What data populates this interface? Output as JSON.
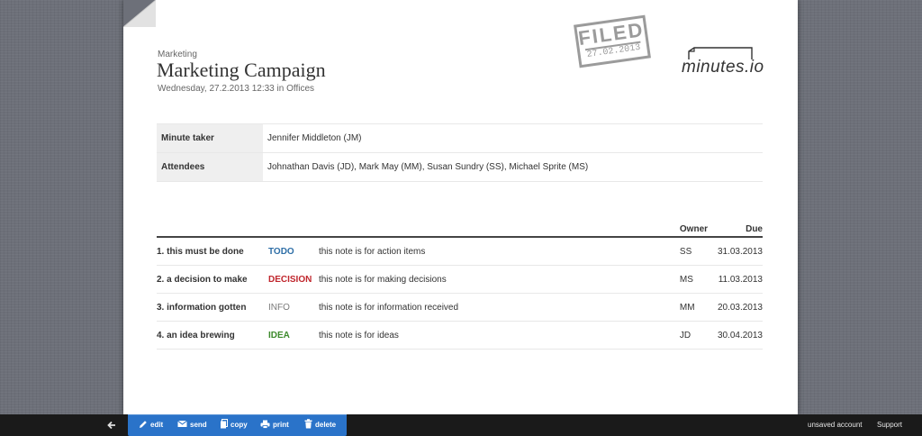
{
  "header": {
    "category": "Marketing",
    "title": "Marketing Campaign",
    "subtitle": "Wednesday, 27.2.2013 12:33 in Offices"
  },
  "stamp": {
    "word": "FILED",
    "date": "27.02.2013"
  },
  "logo": {
    "text": "minutes.io"
  },
  "meta": {
    "rows": [
      {
        "label": "Minute taker",
        "value": "Jennifer Middleton (JM)"
      },
      {
        "label": "Attendees",
        "value": "Johnathan Davis (JD), Mark May (MM), Susan Sundry (SS), Michael Sprite (MS)"
      }
    ]
  },
  "items": {
    "headers": {
      "owner": "Owner",
      "due": "Due"
    },
    "rows": [
      {
        "title": "1. this must be done",
        "type": "TODO",
        "note": "this note is for action items",
        "owner": "SS",
        "due": "31.03.2013",
        "type_color": "#2f6fa7"
      },
      {
        "title": "2. a decision to make",
        "type": "DECISION",
        "note": "this note is for making decisions",
        "owner": "MS",
        "due": "11.03.2013",
        "type_color": "#c0262d"
      },
      {
        "title": "3. information gotten",
        "type": "INFO",
        "note": "this note is for information received",
        "owner": "MM",
        "due": "20.03.2013",
        "type_color": "#7a7a7a"
      },
      {
        "title": "4. an idea brewing",
        "type": "IDEA",
        "note": "this note is for ideas",
        "owner": "JD",
        "due": "30.04.2013",
        "type_color": "#3d8a2c"
      }
    ]
  },
  "toolbar": {
    "back_icon": "arrow-left-icon",
    "accent": "#2a73c9",
    "actions": [
      {
        "label": "edit",
        "icon": "pencil-icon"
      },
      {
        "label": "send",
        "icon": "envelope-icon"
      },
      {
        "label": "copy",
        "icon": "copy-icon"
      },
      {
        "label": "print",
        "icon": "printer-icon"
      },
      {
        "label": "delete",
        "icon": "trash-icon"
      }
    ],
    "links": {
      "account": "unsaved account",
      "support": "Support"
    }
  }
}
